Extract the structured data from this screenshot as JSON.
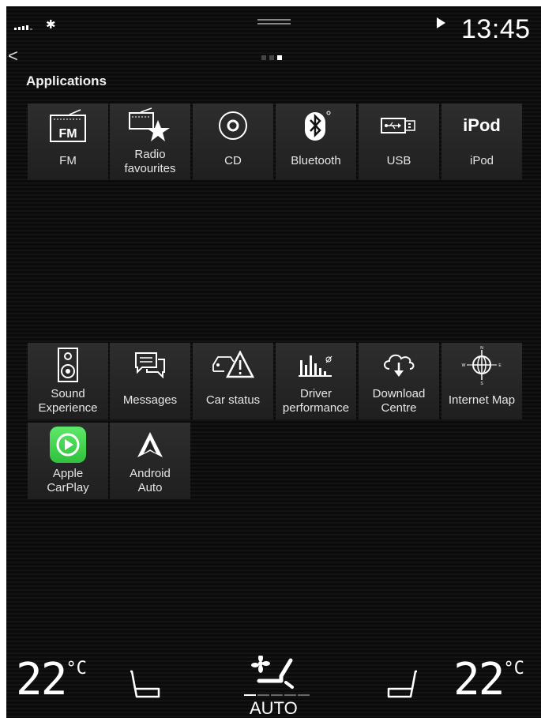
{
  "status": {
    "time": "13:45"
  },
  "pager": {
    "pages": 3,
    "active": 2
  },
  "section": {
    "title": "Applications"
  },
  "apps_row1": [
    {
      "label": "FM",
      "icon": "fm-radio-icon"
    },
    {
      "label": "Radio favourites",
      "icon": "radio-star-icon"
    },
    {
      "label": "CD",
      "icon": "cd-icon"
    },
    {
      "label": "Bluetooth",
      "icon": "bluetooth-icon"
    },
    {
      "label": "USB",
      "icon": "usb-icon"
    },
    {
      "label": "iPod",
      "icon": "ipod-icon",
      "icon_text": "iPod"
    }
  ],
  "apps_row2": [
    {
      "label": "Sound Experience",
      "icon": "speaker-icon"
    },
    {
      "label": "Messages",
      "icon": "messages-icon"
    },
    {
      "label": "Car status",
      "icon": "car-warning-icon"
    },
    {
      "label": "Driver performance",
      "icon": "bar-chart-icon"
    },
    {
      "label": "Download Centre",
      "icon": "cloud-download-icon"
    },
    {
      "label": "Internet Map",
      "icon": "compass-icon"
    }
  ],
  "apps_row3": [
    {
      "label": "Apple CarPlay",
      "icon": "carplay-icon"
    },
    {
      "label": "Android Auto",
      "icon": "android-auto-icon"
    }
  ],
  "icon_text": {
    "fm": "FM"
  },
  "climate": {
    "left_temp": "22",
    "right_temp": "22",
    "unit": "°C",
    "mode": "AUTO"
  },
  "colors": {
    "carplay": "#3ecf4a",
    "tile": "#2a2a2a",
    "background": "#0f0f0f"
  }
}
